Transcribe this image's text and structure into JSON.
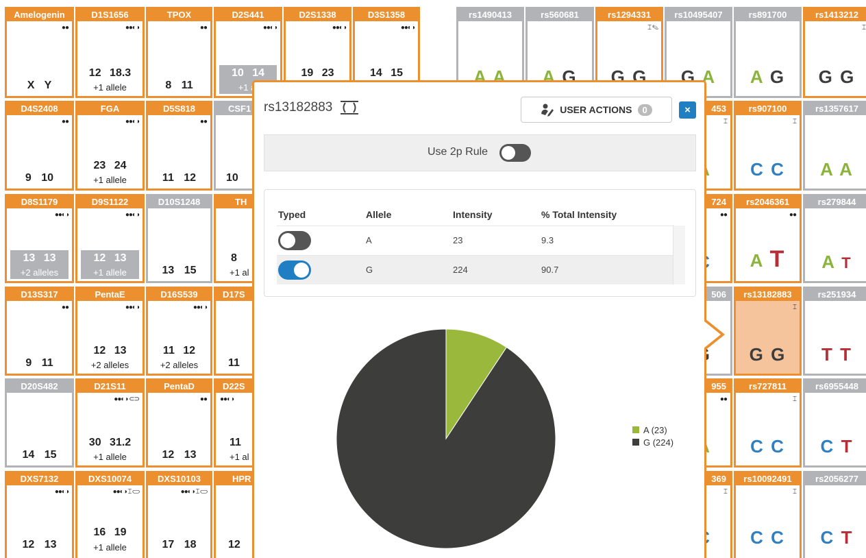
{
  "str_tiles": [
    {
      "name": "Amelogenin",
      "icons": "●●",
      "values": "X Y",
      "note": ""
    },
    {
      "name": "D1S1656",
      "icons": "●●◐◑",
      "values": "12 18.3",
      "note": "+1 allele"
    },
    {
      "name": "TPOX",
      "icons": "●●",
      "values": "8 11",
      "note": ""
    },
    {
      "name": "D2S441",
      "icons": "●●◐◑",
      "values": "10 14",
      "note": "+1 al"
    },
    {
      "name": "D2S1338",
      "icons": "●●◐◑",
      "values": "19 23",
      "note": ""
    },
    {
      "name": "D3S1358",
      "icons": "●●◐◑",
      "values": "14 15",
      "note": ""
    },
    {
      "name": "D4S2408",
      "icons": "●●",
      "values": "9 10",
      "note": ""
    },
    {
      "name": "FGA",
      "icons": "●●◐◑",
      "values": "23 24",
      "note": "+1 allele"
    },
    {
      "name": "D5S818",
      "icons": "●●",
      "values": "11 12",
      "note": ""
    },
    {
      "name": "CSF1",
      "icons": "",
      "values": "10",
      "note": ""
    },
    {
      "name": "D8S1179",
      "icons": "●●◐◑",
      "values": "13 13",
      "note": "+2 alleles"
    },
    {
      "name": "D9S1122",
      "icons": "●●◐◑",
      "values": "12 13",
      "note": "+1 allele"
    },
    {
      "name": "D10S1248",
      "icons": "",
      "values": "13 15",
      "note": ""
    },
    {
      "name": "TH",
      "icons": "",
      "values": "8",
      "note": "+1 al"
    },
    {
      "name": "D13S317",
      "icons": "●●",
      "values": "9 11",
      "note": ""
    },
    {
      "name": "PentaE",
      "icons": "●●◐◑",
      "values": "12 13",
      "note": "+2 alleles"
    },
    {
      "name": "D16S539",
      "icons": "●●◐◑",
      "values": "11 12",
      "note": "+2 alleles"
    },
    {
      "name": "D17S",
      "icons": "",
      "values": "11",
      "note": ""
    },
    {
      "name": "D20S482",
      "icons": "",
      "values": "14 15",
      "note": ""
    },
    {
      "name": "D21S11",
      "icons": "●●◐◑ ⊂⊃",
      "values": "30 31.2",
      "note": "+1 allele"
    },
    {
      "name": "PentaD",
      "icons": "●●",
      "values": "12 13",
      "note": ""
    },
    {
      "name": "D22S",
      "icons": "●●◐◑",
      "values": "11",
      "note": "+1 al"
    },
    {
      "name": "DXS7132",
      "icons": "●●◐◑",
      "values": "12 13",
      "note": ""
    },
    {
      "name": "DXS10074",
      "icons": "●●◐◑ ⌶ ⊂⊃",
      "values": "16 19",
      "note": "+1 allele"
    },
    {
      "name": "DXS10103",
      "icons": "●●◐◑ ⌶ ⊂⊃",
      "values": "17 18",
      "note": ""
    },
    {
      "name": "HPR",
      "icons": "",
      "values": "12",
      "note": ""
    }
  ],
  "snp_tiles": [
    {
      "name": "rs1490413",
      "genotype": [
        "A",
        "A"
      ]
    },
    {
      "name": "rs560681",
      "genotype": [
        "A",
        "G"
      ]
    },
    {
      "name": "rs1294331",
      "genotype": [
        "G",
        "G"
      ]
    },
    {
      "name": "rs10495407",
      "genotype": [
        "G",
        "A"
      ]
    },
    {
      "name": "rs891700",
      "genotype": [
        "A",
        "G"
      ]
    },
    {
      "name": "rs1413212",
      "genotype": [
        "G",
        "G"
      ]
    },
    {
      "name": "453",
      "genotype": [
        "A"
      ]
    },
    {
      "name": "rs907100",
      "genotype": [
        "C",
        "C"
      ]
    },
    {
      "name": "rs1357617",
      "genotype": [
        "A",
        "A"
      ]
    },
    {
      "name": "724",
      "genotype": [
        "C"
      ]
    },
    {
      "name": "rs2046361",
      "genotype": [
        "A",
        "T"
      ]
    },
    {
      "name": "rs279844",
      "genotype": [
        "A",
        "T"
      ]
    },
    {
      "name": "506",
      "genotype": [
        "G"
      ]
    },
    {
      "name": "rs13182883",
      "genotype": [
        "G",
        "G"
      ]
    },
    {
      "name": "rs251934",
      "genotype": [
        "T",
        "T"
      ]
    },
    {
      "name": "955",
      "genotype": [
        "A"
      ]
    },
    {
      "name": "rs727811",
      "genotype": [
        "C",
        "C"
      ]
    },
    {
      "name": "rs6955448",
      "genotype": [
        "C",
        "T"
      ]
    },
    {
      "name": "369",
      "genotype": [
        "C"
      ]
    },
    {
      "name": "rs10092491",
      "genotype": [
        "C",
        "C"
      ]
    },
    {
      "name": "rs2056277",
      "genotype": [
        "C",
        "T"
      ]
    }
  ],
  "popup": {
    "title": "rs13182883",
    "user_actions_label": "USER ACTIONS",
    "user_actions_count": "0",
    "close_label": "×",
    "rule_label": "Use 2p Rule",
    "rule_on": false,
    "table": {
      "columns": [
        "Typed",
        "Allele",
        "Intensity",
        "% Total Intensity"
      ],
      "rows": [
        {
          "typed": false,
          "allele": "A",
          "intensity": "23",
          "percent": "9.3"
        },
        {
          "typed": true,
          "allele": "G",
          "intensity": "224",
          "percent": "90.7"
        }
      ]
    }
  },
  "chart_data": {
    "type": "pie",
    "labels": [
      "A (23)",
      "G (224)"
    ],
    "values": [
      23,
      224
    ],
    "colors": [
      "#9ab83c",
      "#3d3e3b"
    ],
    "legend": "right"
  },
  "colors": {
    "accent": "#ec8f2e",
    "muted": "#b1b3b6",
    "primary": "#1f7fc2",
    "A": "#8ab43c",
    "C": "#2f7fc1",
    "G": "#3d3d3d",
    "T": "#b53036"
  }
}
